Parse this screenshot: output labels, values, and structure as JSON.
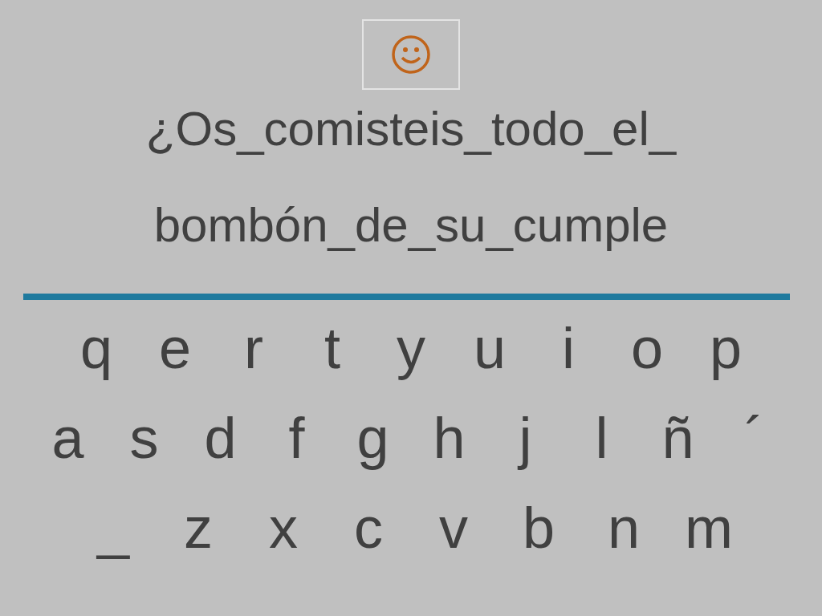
{
  "phrase_lines": [
    "¿Os_comisteis_todo_el_",
    "bombón_de_su_cumple"
  ],
  "keyboard_rows": [
    [
      "q",
      "e",
      "r",
      "t",
      "y",
      "u",
      "i",
      "o",
      "p"
    ],
    [
      "a",
      "s",
      "d",
      "f",
      "g",
      "h",
      "j",
      "l",
      "ñ",
      "´"
    ],
    [
      "_",
      "z",
      "x",
      "c",
      "v",
      "b",
      "n",
      "m"
    ]
  ]
}
